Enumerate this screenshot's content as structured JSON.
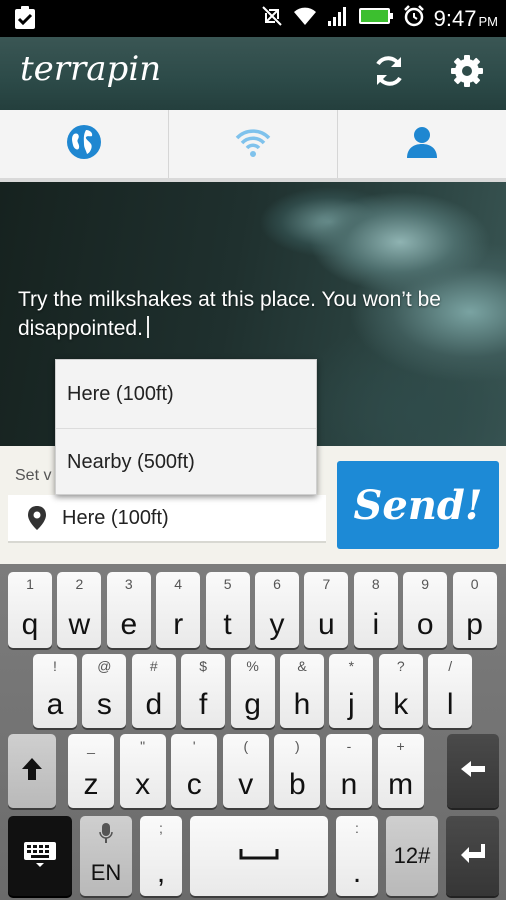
{
  "status_bar": {
    "time": "9:47",
    "ampm": "PM",
    "icons": [
      "clipboard-check-icon",
      "no-sync-icon",
      "wifi-icon",
      "signal-icon",
      "battery-icon",
      "alarm-icon"
    ]
  },
  "app": {
    "logo": "terrapin",
    "header_icons": [
      "refresh-icon",
      "settings-icon"
    ]
  },
  "tabs": [
    {
      "name": "globe",
      "icon": "globe-icon"
    },
    {
      "name": "nearby",
      "icon": "wifi-signal-icon"
    },
    {
      "name": "profile",
      "icon": "person-icon"
    }
  ],
  "hero": {
    "message": "Try the milkshakes at this place. You won’t be disappointed."
  },
  "compose": {
    "set_label": "Set v",
    "where_value": "Here (100ft)",
    "send_label": "Send!"
  },
  "dropdown": {
    "options": [
      "Here (100ft)",
      "Nearby (500ft)"
    ]
  },
  "keyboard": {
    "row1": [
      {
        "sub": "1",
        "main": "q"
      },
      {
        "sub": "2",
        "main": "w"
      },
      {
        "sub": "3",
        "main": "e"
      },
      {
        "sub": "4",
        "main": "r"
      },
      {
        "sub": "5",
        "main": "t"
      },
      {
        "sub": "6",
        "main": "y"
      },
      {
        "sub": "7",
        "main": "u"
      },
      {
        "sub": "8",
        "main": "i"
      },
      {
        "sub": "9",
        "main": "o"
      },
      {
        "sub": "0",
        "main": "p"
      }
    ],
    "row2": [
      {
        "sub": "!",
        "main": "a"
      },
      {
        "sub": "@",
        "main": "s"
      },
      {
        "sub": "#",
        "main": "d"
      },
      {
        "sub": "$",
        "main": "f"
      },
      {
        "sub": "%",
        "main": "g"
      },
      {
        "sub": "&",
        "main": "h"
      },
      {
        "sub": "*",
        "main": "j"
      },
      {
        "sub": "?",
        "main": "k"
      },
      {
        "sub": "/",
        "main": "l"
      }
    ],
    "row3": [
      {
        "sub": "_",
        "main": "z"
      },
      {
        "sub": "\"",
        "main": "x"
      },
      {
        "sub": "'",
        "main": "c"
      },
      {
        "sub": "(",
        "main": "v"
      },
      {
        "sub": ")",
        "main": "b"
      },
      {
        "sub": "-",
        "main": "n"
      },
      {
        "sub": "+",
        "main": "m"
      }
    ],
    "mic_label": "EN",
    "comma_sub": ";",
    "comma_main": ",",
    "period_sub": ":",
    "period_main": ".",
    "symbols_label": "12#"
  }
}
